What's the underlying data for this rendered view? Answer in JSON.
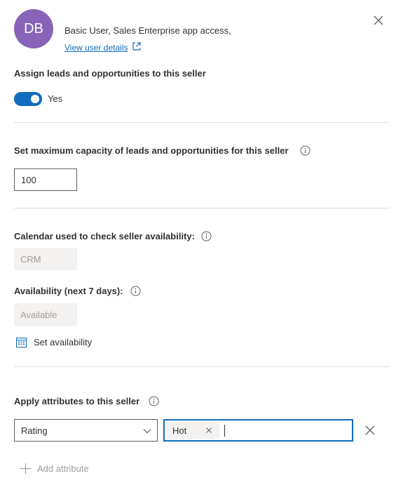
{
  "user": {
    "initials": "DB",
    "description": "Basic User, Sales Enterprise app access,",
    "view_details_label": "View user details"
  },
  "assign": {
    "label": "Assign leads and opportunities to this seller",
    "toggle_on": true,
    "toggle_text": "Yes"
  },
  "capacity": {
    "label": "Set maximum capacity of leads and opportunities for this seller",
    "value": "100"
  },
  "calendar": {
    "label": "Calendar used to check seller availability:",
    "value": "CRM"
  },
  "availability": {
    "label": "Availability (next 7 days):",
    "value": "Available",
    "set_label": "Set availability"
  },
  "attributes": {
    "label": "Apply attributes to this seller",
    "rows": [
      {
        "attribute": "Rating",
        "values": [
          "Hot"
        ]
      }
    ],
    "add_label": "Add attribute"
  },
  "colors": {
    "accent": "#0f6cbd",
    "avatar": "#8764b8",
    "divider": "#e1dfdd",
    "disabled_bg": "#f3f2f1"
  }
}
